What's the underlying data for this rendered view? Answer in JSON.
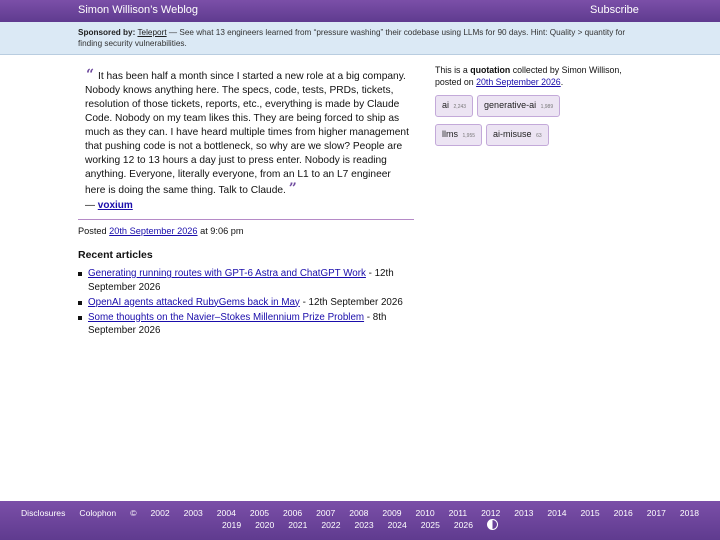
{
  "header": {
    "title": "Simon Willison’s Weblog",
    "subscribe": "Subscribe"
  },
  "sponsor": {
    "label": "Sponsored by:",
    "link": "Teleport",
    "text": "— See what 13 engineers learned from “pressure washing” their codebase using LLMs for 90 days. Hint: Quality > quantity for finding security vulnerabilities."
  },
  "quote": {
    "open": "“",
    "close": "”",
    "text": "It has been half a month since I started a new role at a big company. Nobody knows anything here. The specs, code, tests, PRDs, tickets, resolution of those tickets, reports, etc., everything is made by Claude Code. Nobody on my team likes this. They are being forced to ship as much as they can. I have heard multiple times from higher management that pushing code is not a bottleneck, so why are we slow? People are working 12 to 13 hours a day just to press enter. Nobody is reading anything. Everyone, literally everyone, from an L1 to an L7 engineer here is doing the same thing. Talk to Claude.",
    "cite_prefix": "— ",
    "cite": "voxium"
  },
  "posted": {
    "prefix": "Posted ",
    "date": "20th September 2026",
    "suffix": " at 9:06 pm"
  },
  "recent": {
    "heading": "Recent articles",
    "items": [
      {
        "title": "Generating running routes with GPT-6 Astra and ChatGPT Work",
        "date": " - 12th September 2026"
      },
      {
        "title": "OpenAI agents attacked RubyGems back in May",
        "date": " - 12th September 2026"
      },
      {
        "title": "Some thoughts on the Navier–Stokes Millennium Prize Problem",
        "date": " - 8th September 2026"
      }
    ]
  },
  "sidebar": {
    "prefix": "This is a ",
    "type": "quotation",
    "mid": " collected by Simon Willison, posted on ",
    "date": "20th September 2026",
    "end": ".",
    "tags": [
      {
        "name": "ai",
        "count": "2,243"
      },
      {
        "name": "generative-ai",
        "count": "1,989"
      },
      {
        "name": "llms",
        "count": "1,955"
      },
      {
        "name": "ai-misuse",
        "count": "63"
      }
    ]
  },
  "footer": {
    "disclosures": "Disclosures",
    "colophon": "Colophon",
    "copyright": "©",
    "years": [
      "2002",
      "2003",
      "2004",
      "2005",
      "2006",
      "2007",
      "2008",
      "2009",
      "2010",
      "2011",
      "2012",
      "2013",
      "2014",
      "2015",
      "2016",
      "2017",
      "2018",
      "2019",
      "2020",
      "2021",
      "2022",
      "2023",
      "2024",
      "2025",
      "2026"
    ],
    "contrast_icon": "contrast-icon"
  }
}
